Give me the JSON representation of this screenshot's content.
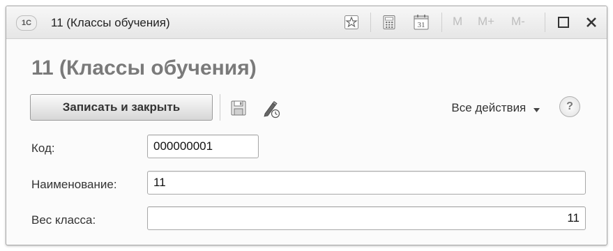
{
  "window": {
    "logo": "1C",
    "title": "11 (Классы обучения)",
    "toolbar": {
      "m": "M",
      "m_plus": "M+",
      "m_minus": "M-"
    }
  },
  "form": {
    "heading": "11 (Классы обучения)",
    "save_close_label": "Записать и закрыть",
    "all_actions_label": "Все действия",
    "help_label": "?"
  },
  "fields": {
    "code": {
      "label": "Код:",
      "value": "000000001"
    },
    "name": {
      "label": "Наименование:",
      "value": "11"
    },
    "weight": {
      "label": "Вес класса:",
      "value": "11"
    }
  },
  "icons": {
    "favorite": "star-icon",
    "calculator": "calculator-icon",
    "calendar": "calendar-icon",
    "calendar_day": "31",
    "maximize": "maximize-icon",
    "close": "close-icon",
    "save": "floppy-disk-icon",
    "edit_history": "pencil-clock-icon",
    "dropdown": "triangle-down-icon",
    "help": "help-icon"
  }
}
